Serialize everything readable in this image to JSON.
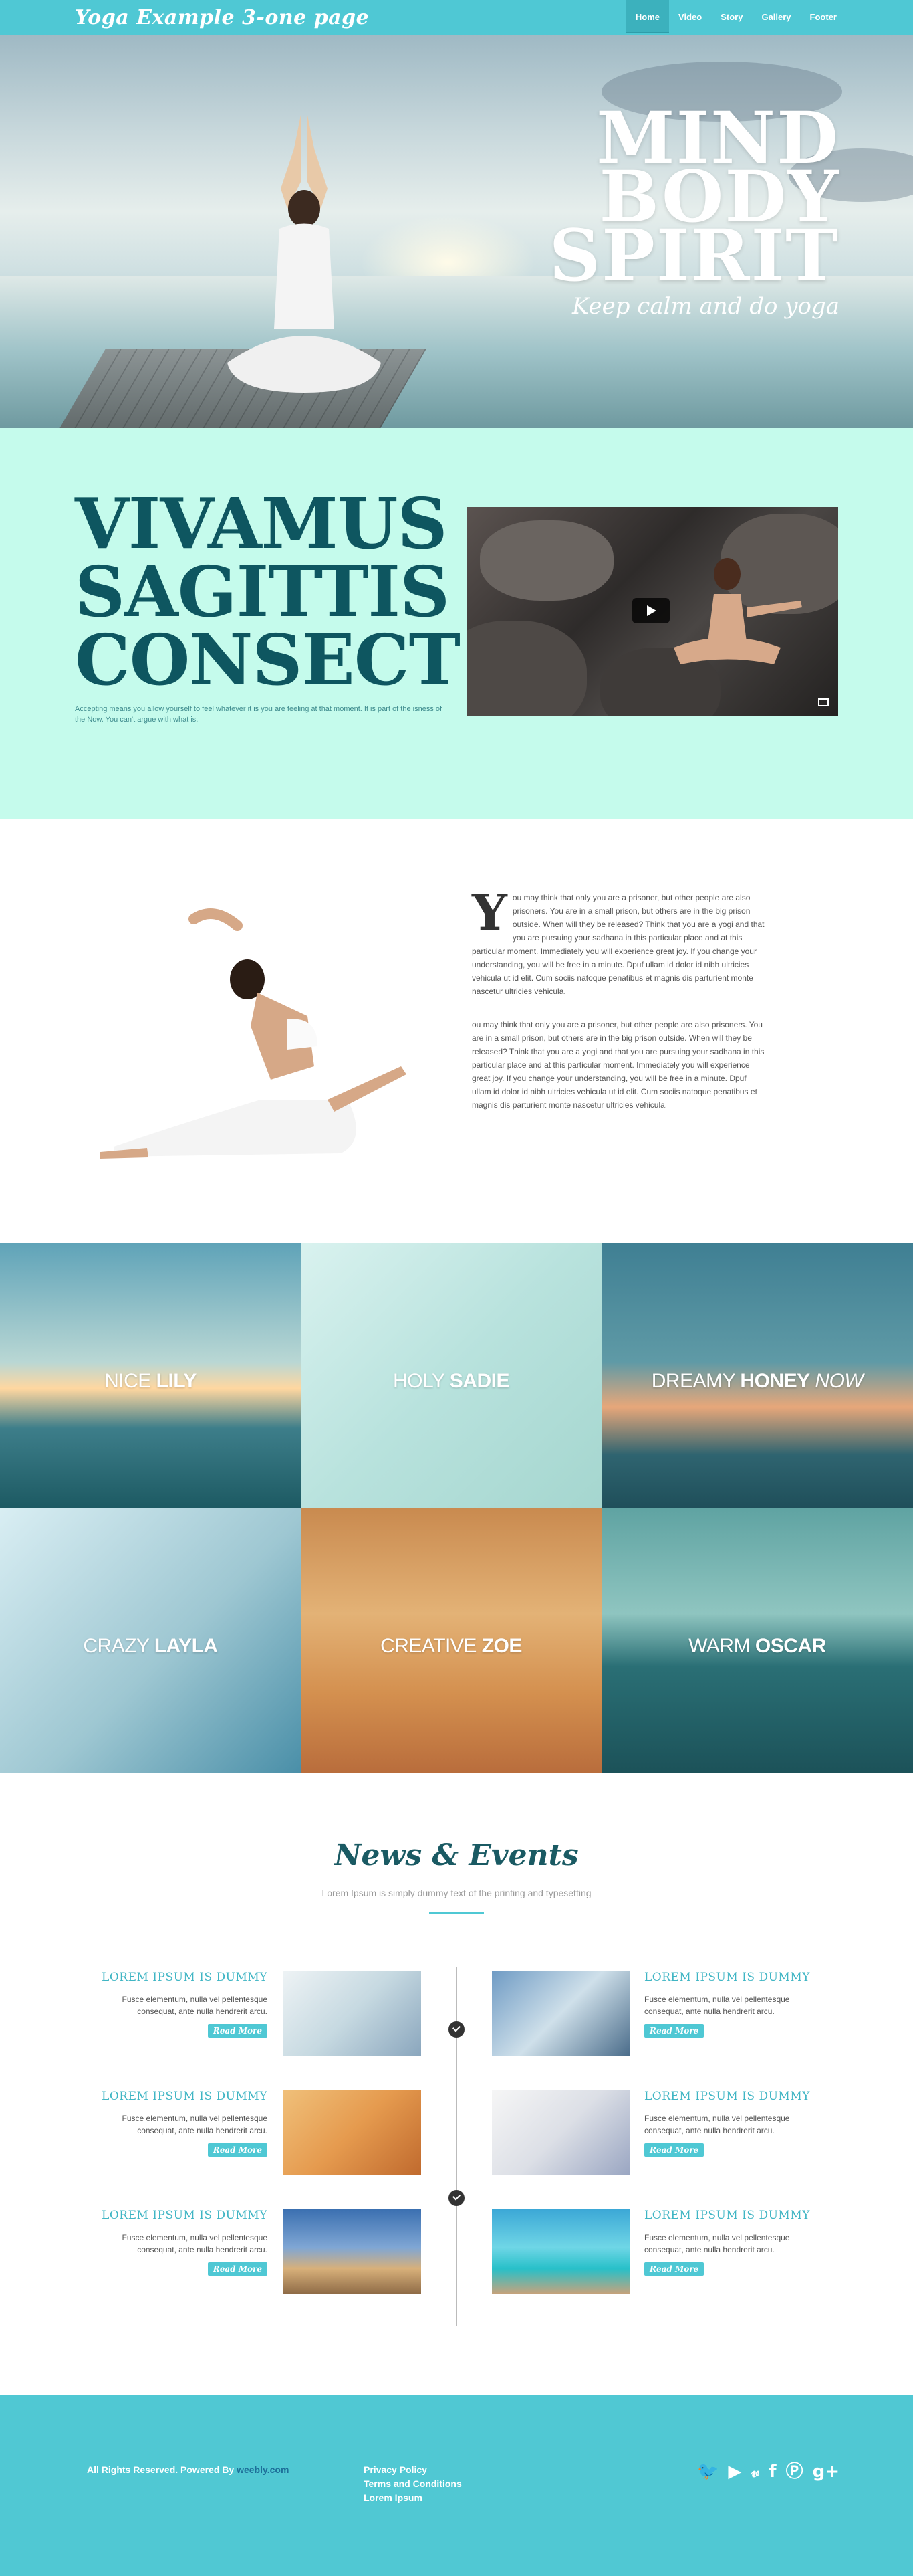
{
  "nav": {
    "brand": "Yoga Example 3-one page",
    "items": [
      {
        "label": "Home",
        "active": true
      },
      {
        "label": "Video"
      },
      {
        "label": "Story"
      },
      {
        "label": "Gallery"
      },
      {
        "label": "Footer"
      }
    ]
  },
  "hero": {
    "lines": [
      "MIND",
      "BODY",
      "SPIRIT"
    ],
    "tagline": "Keep calm and do yoga"
  },
  "intro": {
    "title": [
      "VIVAMUS",
      "SAGITTIS",
      "CONSECT"
    ],
    "text": "Accepting means you allow yourself to feel whatever it is you are feeling at that moment. It is part of the isness of the Now. You can't argue with what is.",
    "video": {
      "play_icon": "play-icon",
      "fullscreen_icon": "fullscreen-icon"
    }
  },
  "story": {
    "dropcap": "Y",
    "paragraph1": "ou may think that only you are a prisoner, but other people are also prisoners. You are in a small prison, but others are in the big prison outside. When will they be released? Think that you are a yogi and that you are pursuing your sadhana in this particular place and at this particular moment. Immediately you will experience great joy. If you change your understanding, you will be free in a minute. Dpuf ullam id dolor id nibh ultricies vehicula ut id elit. Cum sociis natoque penatibus et magnis dis parturient monte nascetur ultricies vehicula.",
    "paragraph2": "ou may think that only you are a prisoner, but other people are also prisoners. You are in a small prison, but others are in the big prison outside. When will they be released? Think that you are a yogi and that you are pursuing your sadhana in this particular place and at this particular moment. Immediately you will experience great joy. If you change your understanding, you will be free in a minute. Dpuf ullam id dolor id nibh ultricies vehicula ut id elit. Cum sociis natoque penatibus et magnis dis parturient monte nascetur ultricies vehicula."
  },
  "gallery": [
    {
      "pre": "NICE ",
      "bold": "LILY",
      "post": ""
    },
    {
      "pre": "HOLY ",
      "bold": "SADIE",
      "post": ""
    },
    {
      "pre": "DREAMY ",
      "bold": "HONEY",
      "post": " NOW"
    },
    {
      "pre": "CRAZY ",
      "bold": "LAYLA",
      "post": ""
    },
    {
      "pre": "CREATIVE ",
      "bold": "ZOE",
      "post": ""
    },
    {
      "pre": "WARM ",
      "bold": "OSCAR",
      "post": ""
    }
  ],
  "news": {
    "title": "News & Events",
    "subtitle": "Lorem Ipsum is simply dummy text of the printing and typesetting",
    "items": [
      {
        "title": "LOREM IPSUM IS DUMMY",
        "desc": "Fusce elementum, nulla vel pellentesque consequat, ante nulla hendrerit arcu.",
        "button": "Read More"
      },
      {
        "title": "LOREM IPSUM IS DUMMY",
        "desc": "Fusce elementum, nulla vel pellentesque consequat, ante nulla hendrerit arcu.",
        "button": "Read More"
      },
      {
        "title": "LOREM IPSUM IS DUMMY",
        "desc": "Fusce elementum, nulla vel pellentesque consequat, ante nulla hendrerit arcu.",
        "button": "Read More"
      },
      {
        "title": "LOREM IPSUM IS DUMMY",
        "desc": "Fusce elementum, nulla vel pellentesque consequat, ante nulla hendrerit arcu.",
        "button": "Read More"
      },
      {
        "title": "LOREM IPSUM IS DUMMY",
        "desc": "Fusce elementum, nulla vel pellentesque consequat, ante nulla hendrerit arcu.",
        "button": "Read More"
      },
      {
        "title": "LOREM IPSUM IS DUMMY",
        "desc": "Fusce elementum, nulla vel pellentesque consequat, ante nulla hendrerit arcu.",
        "button": "Read More"
      }
    ]
  },
  "footer": {
    "copyright": "All Rights Reserved. Powered By ",
    "powered_by": "weebly.com",
    "links": [
      "Privacy Policy",
      "Terms and Conditions",
      "Lorem Ipsum"
    ],
    "social": [
      "twitter-icon",
      "youtube-icon",
      "vimeo-icon",
      "facebook-icon",
      "pinterest-icon",
      "googleplus-icon"
    ]
  },
  "colors": {
    "accent": "#4fc8d4",
    "intro_bg": "#c5fbec",
    "title_dark": "#0e5660"
  }
}
